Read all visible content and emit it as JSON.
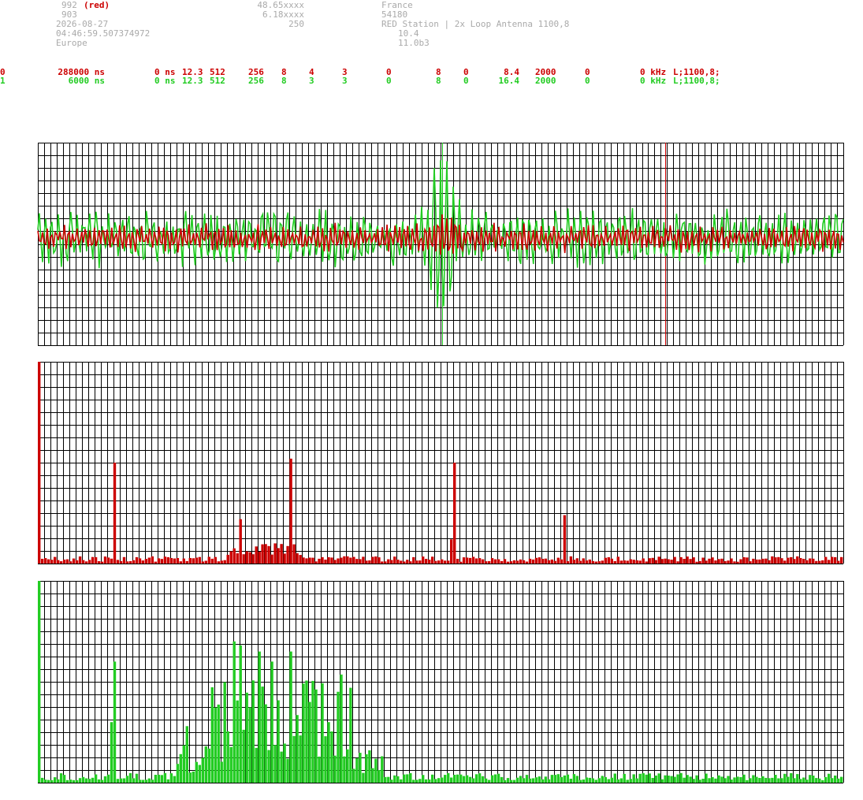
{
  "header": {
    "col1": {
      "line1_num": "992",
      "line1_tag": "(red)",
      "line2": "903",
      "line3": "2026-08-27",
      "line4": "04:46:59.507374972",
      "line5": "Europe"
    },
    "col2": {
      "line1": "48.65xxxx",
      "line2": "6.18xxxx",
      "line3": "250"
    },
    "col3": {
      "line1": "France",
      "line2": "54180",
      "line3": "RED Station | 2x Loop Antenna 1100,8",
      "line4": "10.4",
      "line5": "11.0b3"
    }
  },
  "channels": [
    {
      "id": "0",
      "delay": "288000 ns",
      "offset": "0 ns",
      "gain": "12.3",
      "n1": "512",
      "n2": "256",
      "n3": "8",
      "n4": "4",
      "n5": "3",
      "n6": "0",
      "n7": "8",
      "n8": "0",
      "n9": "8.4",
      "n10": "2000",
      "n11": "0",
      "freq": "0 kHz",
      "label": "L;1100,8;",
      "color": "#cc0000"
    },
    {
      "id": "1",
      "delay": "6000 ns",
      "offset": "0 ns",
      "gain": "12.3",
      "n1": "512",
      "n2": "256",
      "n3": "8",
      "n4": "3",
      "n5": "3",
      "n6": "0",
      "n7": "8",
      "n8": "0",
      "n9": "16.4",
      "n10": "2000",
      "n11": "0",
      "freq": "0 kHz",
      "label": "L;1100,8;",
      "color": "#22cc22"
    }
  ],
  "chart_data": [
    {
      "type": "line",
      "grid": true,
      "ylim": [
        -1,
        1
      ],
      "series": [
        {
          "color": "#cc0000",
          "amplitude": 0.15,
          "seed": 7
        },
        {
          "color": "#22cc22",
          "amplitude": 0.3,
          "seed": 13
        }
      ],
      "markers": [
        {
          "x": 0.502,
          "color": "#22cc22"
        },
        {
          "x": 0.779,
          "color": "#cc0000"
        }
      ]
    },
    {
      "type": "bar",
      "grid": true,
      "color": "#cc0000",
      "bins": 256,
      "ylim": [
        0,
        1
      ],
      "baseline": 0.03,
      "peaks": [
        {
          "bin": 0,
          "value": 1.0
        },
        {
          "bin": 24,
          "value": 0.5
        },
        {
          "bin": 64,
          "value": 0.22
        },
        {
          "bin": 80,
          "value": 0.52
        },
        {
          "bin": 132,
          "value": 0.5
        },
        {
          "bin": 131,
          "value": 0.12
        },
        {
          "bin": 167,
          "value": 0.24
        }
      ]
    },
    {
      "type": "bar",
      "grid": true,
      "color": "#22cc22",
      "bins": 256,
      "ylim": [
        0,
        1
      ],
      "baseline": 0.04,
      "peaks": [
        {
          "bin": 0,
          "value": 1.0
        },
        {
          "bin": 24,
          "value": 0.6
        },
        {
          "bin": 23,
          "value": 0.3
        },
        {
          "bin": 47,
          "value": 0.28
        },
        {
          "bin": 62,
          "value": 0.7
        },
        {
          "bin": 64,
          "value": 0.68
        },
        {
          "bin": 70,
          "value": 0.65
        },
        {
          "bin": 74,
          "value": 0.6
        },
        {
          "bin": 80,
          "value": 0.65
        },
        {
          "bin": 86,
          "value": 0.4
        },
        {
          "bin": 92,
          "value": 0.3
        }
      ]
    }
  ]
}
